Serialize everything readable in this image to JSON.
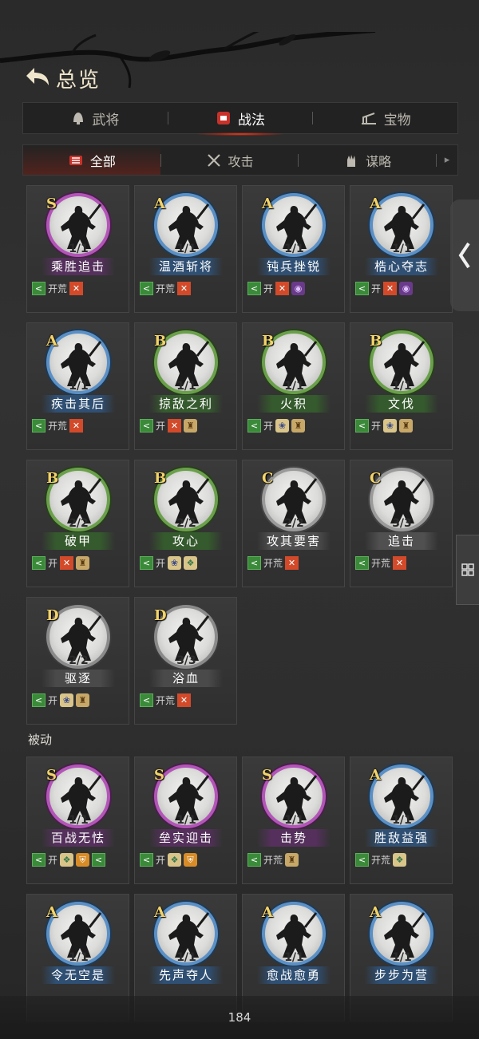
{
  "header": {
    "title": "总览"
  },
  "main_tabs": [
    {
      "label": "武将",
      "icon": "helmet-icon"
    },
    {
      "label": "战法",
      "icon": "fist-icon",
      "active": true
    },
    {
      "label": "宝物",
      "icon": "treasure-icon"
    }
  ],
  "sub_tabs": [
    {
      "label": "全部",
      "icon": "scroll-icon",
      "active": true
    },
    {
      "label": "攻击",
      "icon": "crossed-swords-icon"
    },
    {
      "label": "谋略",
      "icon": "hand-icon"
    }
  ],
  "active_cards": [
    {
      "grade": "S",
      "count": "1/1",
      "name": "乘胜追击",
      "tags": [
        {
          "k": "green",
          "g": "<"
        },
        {
          "k": "text",
          "g": "开荒"
        },
        {
          "k": "red",
          "g": "✕"
        }
      ]
    },
    {
      "grade": "A",
      "count": "1/1",
      "name": "温酒斩将",
      "tags": [
        {
          "k": "green",
          "g": "<"
        },
        {
          "k": "text",
          "g": "开荒"
        },
        {
          "k": "red",
          "g": "✕"
        }
      ]
    },
    {
      "grade": "A",
      "count": "1/1",
      "name": "钝兵挫锐",
      "tags": [
        {
          "k": "green",
          "g": "<"
        },
        {
          "k": "text",
          "g": "开"
        },
        {
          "k": "red",
          "g": "✕"
        },
        {
          "k": "purple",
          "g": "◉"
        }
      ]
    },
    {
      "grade": "A",
      "count": "1/1",
      "name": "梏心夺志",
      "tags": [
        {
          "k": "green",
          "g": "<"
        },
        {
          "k": "text",
          "g": "开"
        },
        {
          "k": "red",
          "g": "✕"
        },
        {
          "k": "purple",
          "g": "◉"
        }
      ]
    },
    {
      "grade": "A",
      "count": "1/1",
      "name": "疾击其后",
      "tags": [
        {
          "k": "green",
          "g": "<"
        },
        {
          "k": "text",
          "g": "开荒"
        },
        {
          "k": "red",
          "g": "✕"
        }
      ]
    },
    {
      "grade": "B",
      "count": "1/1",
      "name": "掠敌之利",
      "tags": [
        {
          "k": "green",
          "g": "<"
        },
        {
          "k": "text",
          "g": "开"
        },
        {
          "k": "red",
          "g": "✕"
        },
        {
          "k": "gold",
          "g": "♜"
        }
      ]
    },
    {
      "grade": "B",
      "count": "1/1",
      "name": "火积",
      "tags": [
        {
          "k": "green",
          "g": "<"
        },
        {
          "k": "text",
          "g": "开"
        },
        {
          "k": "blue",
          "g": "❀"
        },
        {
          "k": "gold",
          "g": "♜"
        }
      ]
    },
    {
      "grade": "B",
      "count": "1/1",
      "name": "文伐",
      "tags": [
        {
          "k": "green",
          "g": "<"
        },
        {
          "k": "text",
          "g": "开"
        },
        {
          "k": "blue",
          "g": "❀"
        },
        {
          "k": "gold",
          "g": "♜"
        }
      ]
    },
    {
      "grade": "B",
      "count": "2/2",
      "name": "破甲",
      "tags": [
        {
          "k": "green",
          "g": "<"
        },
        {
          "k": "text",
          "g": "开"
        },
        {
          "k": "red",
          "g": "✕"
        },
        {
          "k": "gold",
          "g": "♜"
        }
      ]
    },
    {
      "grade": "B",
      "count": "2/2",
      "name": "攻心",
      "tags": [
        {
          "k": "green",
          "g": "<"
        },
        {
          "k": "text",
          "g": "开"
        },
        {
          "k": "blue",
          "g": "❀"
        },
        {
          "k": "teal",
          "g": "❖"
        }
      ]
    },
    {
      "grade": "C",
      "count": "2/2",
      "name": "攻其要害",
      "tags": [
        {
          "k": "green",
          "g": "<"
        },
        {
          "k": "text",
          "g": "开荒"
        },
        {
          "k": "red",
          "g": "✕"
        }
      ]
    },
    {
      "grade": "C",
      "count": "3/3",
      "name": "追击",
      "tags": [
        {
          "k": "green",
          "g": "<"
        },
        {
          "k": "text",
          "g": "开荒"
        },
        {
          "k": "red",
          "g": "✕"
        }
      ]
    },
    {
      "grade": "D",
      "count": "2/2",
      "name": "驱逐",
      "tags": [
        {
          "k": "green",
          "g": "<"
        },
        {
          "k": "text",
          "g": "开"
        },
        {
          "k": "blue",
          "g": "❀"
        },
        {
          "k": "gold",
          "g": "♜"
        }
      ]
    },
    {
      "grade": "D",
      "count": "3/3",
      "name": "浴血",
      "tags": [
        {
          "k": "green",
          "g": "<"
        },
        {
          "k": "text",
          "g": "开荒"
        },
        {
          "k": "red",
          "g": "✕"
        }
      ]
    }
  ],
  "passive_section": {
    "label": "被动"
  },
  "passive_cards": [
    {
      "grade": "S",
      "count": "1/1",
      "name": "百战无怯",
      "tags": [
        {
          "k": "green",
          "g": "<"
        },
        {
          "k": "text",
          "g": "开"
        },
        {
          "k": "teal",
          "g": "❖"
        },
        {
          "k": "orange",
          "g": "⛨"
        },
        {
          "k": "green",
          "g": "<"
        }
      ]
    },
    {
      "grade": "S",
      "count": "1/1",
      "name": "垒实迎击",
      "tags": [
        {
          "k": "green",
          "g": "<"
        },
        {
          "k": "text",
          "g": "开"
        },
        {
          "k": "teal",
          "g": "❖"
        },
        {
          "k": "orange",
          "g": "⛨"
        }
      ]
    },
    {
      "grade": "S",
      "count": "1/1",
      "name": "击势",
      "tags": [
        {
          "k": "green",
          "g": "<"
        },
        {
          "k": "text",
          "g": "开荒"
        },
        {
          "k": "gold",
          "g": "♜"
        }
      ]
    },
    {
      "grade": "A",
      "count": "1/1",
      "name": "胜敌益强",
      "tags": [
        {
          "k": "green",
          "g": "<"
        },
        {
          "k": "text",
          "g": "开荒"
        },
        {
          "k": "teal",
          "g": "❖"
        }
      ]
    },
    {
      "grade": "A",
      "count": "1/1",
      "name": "令无空是",
      "tags": []
    },
    {
      "grade": "A",
      "count": "1/1",
      "name": "先声夺人",
      "tags": []
    },
    {
      "grade": "A",
      "count": "1/1",
      "name": "愈战愈勇",
      "tags": []
    },
    {
      "grade": "A",
      "count": "1/1",
      "name": "步步为营",
      "tags": []
    }
  ],
  "footer": {
    "page_number": "184"
  }
}
